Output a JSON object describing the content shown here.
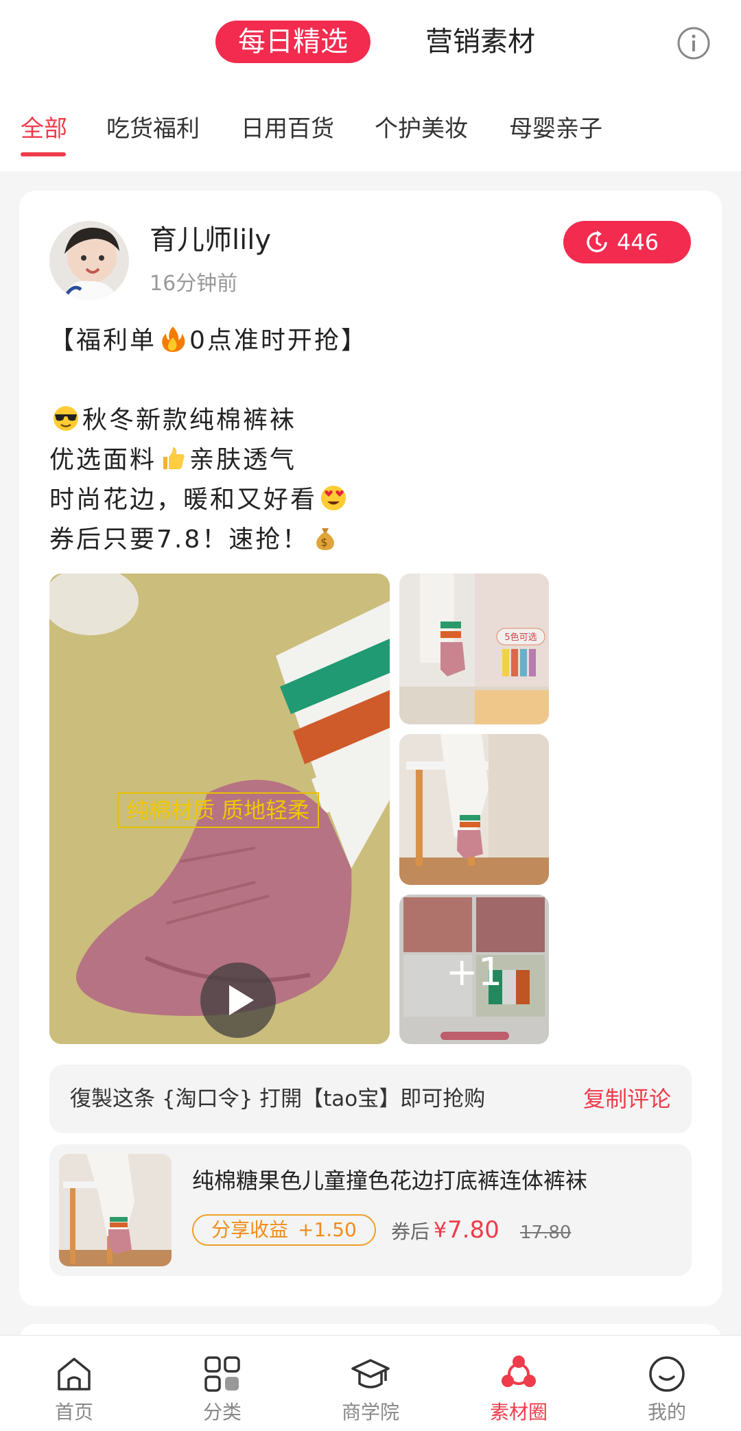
{
  "header": {
    "segments": [
      "每日精选",
      "营销素材"
    ],
    "active_segment": "每日精选",
    "info_icon": "info-icon"
  },
  "tabs": [
    "全部",
    "吃货福利",
    "日用百货",
    "个护美妆",
    "母婴亲子"
  ],
  "active_tab": "全部",
  "post": {
    "author": "育儿师lily",
    "time": "16分钟前",
    "share_count": "446",
    "lines": [
      {
        "before": "【福利单",
        "emoji": "fire-emoji",
        "after": "0点准时开抢】"
      },
      {
        "before": "",
        "emoji": "",
        "after": ""
      },
      {
        "before": "",
        "emoji": "sunglasses-emoji",
        "after": "秋冬新款纯棉裤袜"
      },
      {
        "before": "优选面料",
        "emoji": "thumbs-up-emoji",
        "after": "亲肤透气"
      },
      {
        "before": "时尚花边，暖和又好看",
        "emoji": "heart-eyes-emoji",
        "after": ""
      },
      {
        "before": "券后只要7.8！速抢！",
        "emoji": "money-bag-emoji",
        "after": ""
      }
    ],
    "media": {
      "video_overlay_text": "纯棉材质 质地轻柔",
      "thumb1_tag": "5色可选",
      "more_count": "+1"
    },
    "copy_text": "復製这条 {淘口令} 打開【tao宝】即可抢购",
    "copy_button": "复制评论",
    "product": {
      "title": "纯棉糖果色儿童撞色花边打底裤连体裤袜",
      "earn_label": "分享收益",
      "earn_value": "+1.50",
      "price_label": "券后",
      "currency": "¥",
      "price": "7.80",
      "original_price": "17.80"
    }
  },
  "bottom_nav": [
    {
      "label": "首页",
      "icon": "home-icon"
    },
    {
      "label": "分类",
      "icon": "category-grid-icon"
    },
    {
      "label": "商学院",
      "icon": "graduation-cap-icon"
    },
    {
      "label": "素材圈",
      "icon": "material-circle-icon"
    },
    {
      "label": "我的",
      "icon": "profile-smile-icon"
    }
  ],
  "active_nav": "素材圈",
  "colors": {
    "accent": "#f22b4f",
    "accent_text": "#ef3b4a",
    "earn_orange": "#f08c1a",
    "background": "#f5f5f5"
  }
}
